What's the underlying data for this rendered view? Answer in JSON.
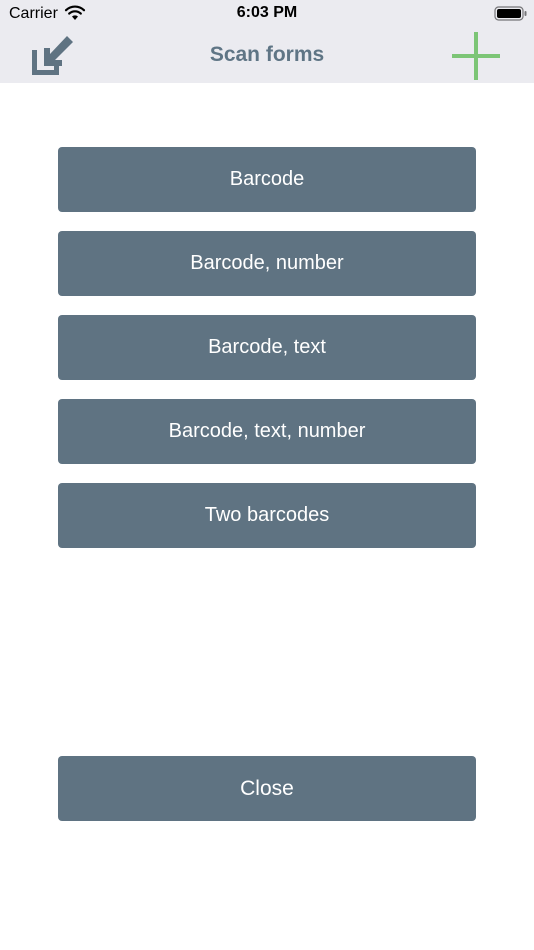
{
  "status_bar": {
    "carrier": "Carrier",
    "time": "6:03 PM",
    "wifi_icon": "wifi-icon",
    "battery_icon": "battery-icon"
  },
  "nav": {
    "title": "Scan forms",
    "left_icon": "import-arrow-icon",
    "right_icon": "plus-icon"
  },
  "forms": [
    {
      "label": "Barcode"
    },
    {
      "label": "Barcode, number"
    },
    {
      "label": "Barcode, text"
    },
    {
      "label": "Barcode, text, number"
    },
    {
      "label": "Two barcodes"
    }
  ],
  "close_label": "Close",
  "colors": {
    "bar_background": "#ebebf0",
    "title": "#5f7585",
    "button": "#5f7382",
    "button_text": "#ffffff",
    "accent_green": "#7cc576"
  }
}
